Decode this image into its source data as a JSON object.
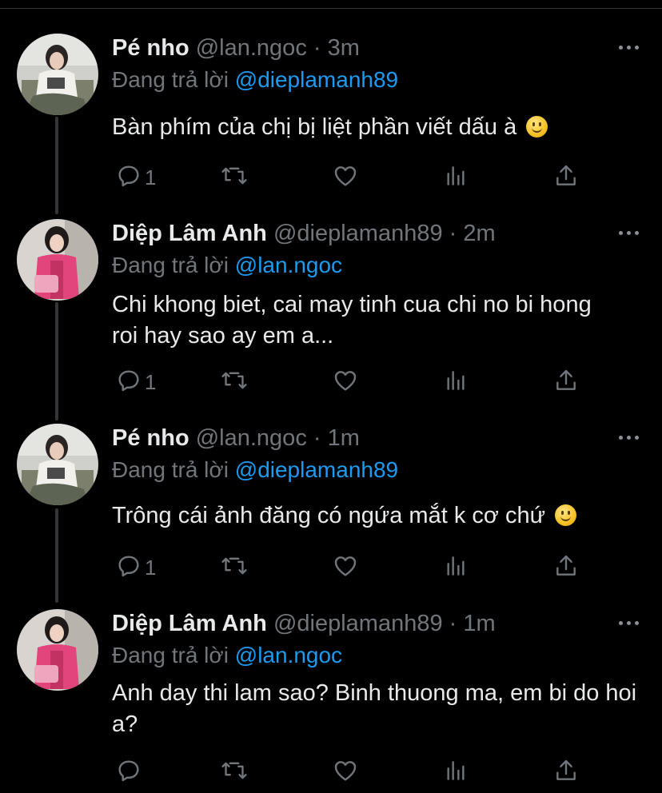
{
  "colors": {
    "background": "#000000",
    "text": "#e7e9ea",
    "muted": "#71767b",
    "link": "#1d9bf0",
    "thread_line": "#333639"
  },
  "icons": {
    "more": "more-horizontal-icon",
    "reply": "reply-icon",
    "retweet": "retweet-icon",
    "like": "heart-icon",
    "views": "views-icon",
    "share": "share-icon",
    "emoji": "slightly-smiling-face-emoji"
  },
  "tweets": [
    {
      "name": "Pé nho",
      "handle": "@lan.ngoc",
      "sep": " · ",
      "time": "3m",
      "replying_prefix": "Đang trả lời ",
      "replying_to": "@dieplamanh89",
      "text": "Bàn phím của chị bị liệt phần viết dấu à",
      "emoji": true,
      "reply_count": "1"
    },
    {
      "name": "Diệp Lâm Anh",
      "handle": "@dieplamanh89",
      "sep": " · ",
      "time": "2m",
      "replying_prefix": "Đang trả lời ",
      "replying_to": "@lan.ngoc",
      "text": "Chi khong biet, cai may tinh cua chi no bi hong roi hay sao ay em a...",
      "emoji": false,
      "reply_count": "1"
    },
    {
      "name": "Pé nho",
      "handle": "@lan.ngoc",
      "sep": " · ",
      "time": "1m",
      "replying_prefix": "Đang trả lời ",
      "replying_to": "@dieplamanh89",
      "text": "Trông cái ảnh đăng có ngứa mắt k cơ chứ",
      "emoji": true,
      "reply_count": "1"
    },
    {
      "name": "Diệp Lâm Anh",
      "handle": "@dieplamanh89",
      "sep": " · ",
      "time": "1m",
      "replying_prefix": "Đang trả lời ",
      "replying_to": "@lan.ngoc",
      "text": "Anh day thi lam sao? Binh thuong ma, em bi do hoi a?",
      "emoji": false,
      "reply_count": ""
    }
  ]
}
